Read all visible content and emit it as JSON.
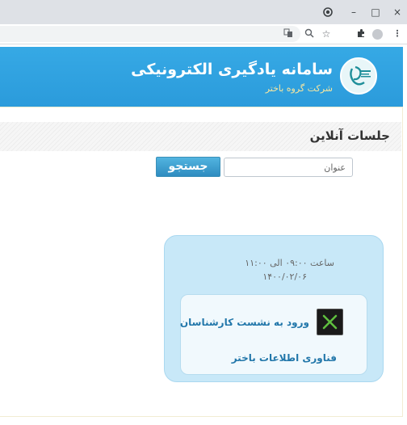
{
  "browser": {
    "window_controls": {
      "minimize": "–",
      "maximize": "□",
      "close": "×"
    },
    "toolbar_icons": [
      "translate-icon",
      "zoom-icon",
      "star-icon",
      "extensions-icon",
      "profile-icon",
      "menu-icon"
    ]
  },
  "header": {
    "title": "سامانه یادگیری الکترونیکی",
    "subtitle": "شرکت گروه باختر"
  },
  "section": {
    "title": "جلسات آنلاین"
  },
  "search": {
    "placeholder": "عنوان",
    "button_label": "جستجو"
  },
  "session": {
    "time": "ساعت ۰۹:۰۰ الی ۱۱:۰۰",
    "date": "۱۴۰۰/۰۲/۰۶",
    "join_label": "ورود به نشست کارشناسان",
    "organization": "فناوری اطلاعات باختر"
  },
  "colors": {
    "header_bg": "#2b9bdb",
    "subtitle": "#f9e79f",
    "card_bg": "#c8e8f8",
    "link": "#2277aa"
  }
}
